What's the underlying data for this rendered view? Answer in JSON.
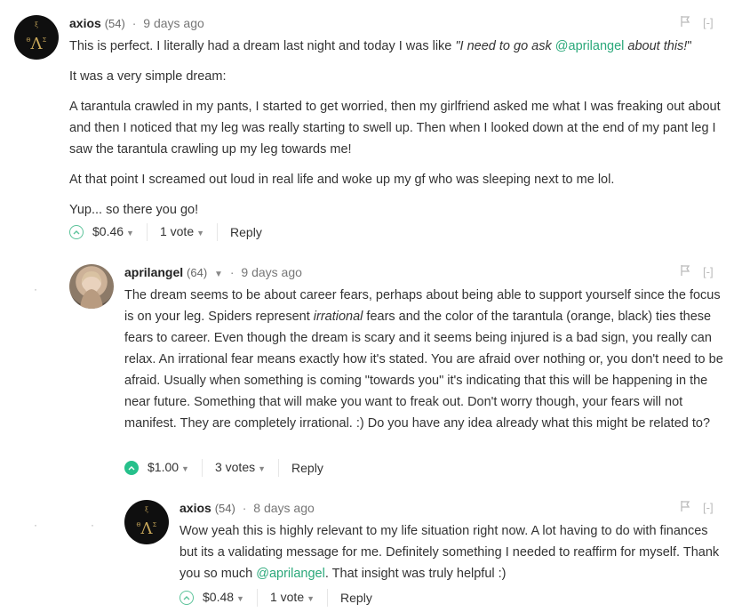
{
  "comments": [
    {
      "author": "axios",
      "rep": "(54)",
      "time": "9 days ago",
      "paragraphs": [
        "A tarantula crawled in my pants, I started to get worried, then my girlfriend asked me what I was freaking out about and then I noticed that my leg was really starting to swell up. Then when I looked down at the end of my pant leg I saw the tarantula crawling up my leg towards me!",
        "At that point I screamed out loud in real life and woke up my gf who was sleeping next to me lol.",
        "Yup... so there you go!"
      ],
      "line1_text": "This is perfect. I literally had a dream last night and today I was like ",
      "line1_quote_start": "\"I need to go ask ",
      "line1_mention": "@aprilangel",
      "line1_quote_end": " about this!",
      "line1_quote_close": "\"",
      "line2": "It was a very simple dream:",
      "payout": "$0.46",
      "votes": "1 vote",
      "reply": "Reply",
      "collapse": "[-]"
    },
    {
      "author": "aprilangel",
      "rep": "(64)",
      "time": "9 days ago",
      "text_a": "The dream seems to be about career fears, perhaps about being able to support yourself since the focus is on your leg. Spiders represent ",
      "text_em": "irrational",
      "text_b": " fears and the color of the tarantula (orange, black) ties these fears to career. Even though the dream is scary and it seems being injured is a bad sign, you really can relax. An irrational fear means exactly how it's stated. You are afraid over nothing or, you don't need to be afraid. Usually when something is coming \"towards you\" it's indicating that this will be happening in the near future. Something that will make you want to freak out. Don't worry though, your fears will not manifest. They are completely irrational. :) Do you have any idea already what this might be related to?",
      "payout": "$1.00",
      "votes": "3 votes",
      "reply": "Reply",
      "collapse": "[-]"
    },
    {
      "author": "axios",
      "rep": "(54)",
      "time": "8 days ago",
      "text_a": "Wow yeah this is highly relevant to my life situation right now. A lot having to do with finances but its a validating message for me. Definitely something I needed to reaffirm for myself. Thank you so much ",
      "mention": "@aprilangel",
      "text_b": ". That insight was truly helpful :)",
      "payout": "$0.48",
      "votes": "1 vote",
      "reply": "Reply",
      "collapse": "[-]"
    }
  ],
  "icons": {
    "upvote": "chevron-up-icon",
    "flag": "flag-icon",
    "dropdown": "caret-down-icon"
  },
  "colors": {
    "mention": "#2aa87a",
    "upvote_filled": "#26c08b",
    "upvote_outline": "#5cc39a"
  }
}
